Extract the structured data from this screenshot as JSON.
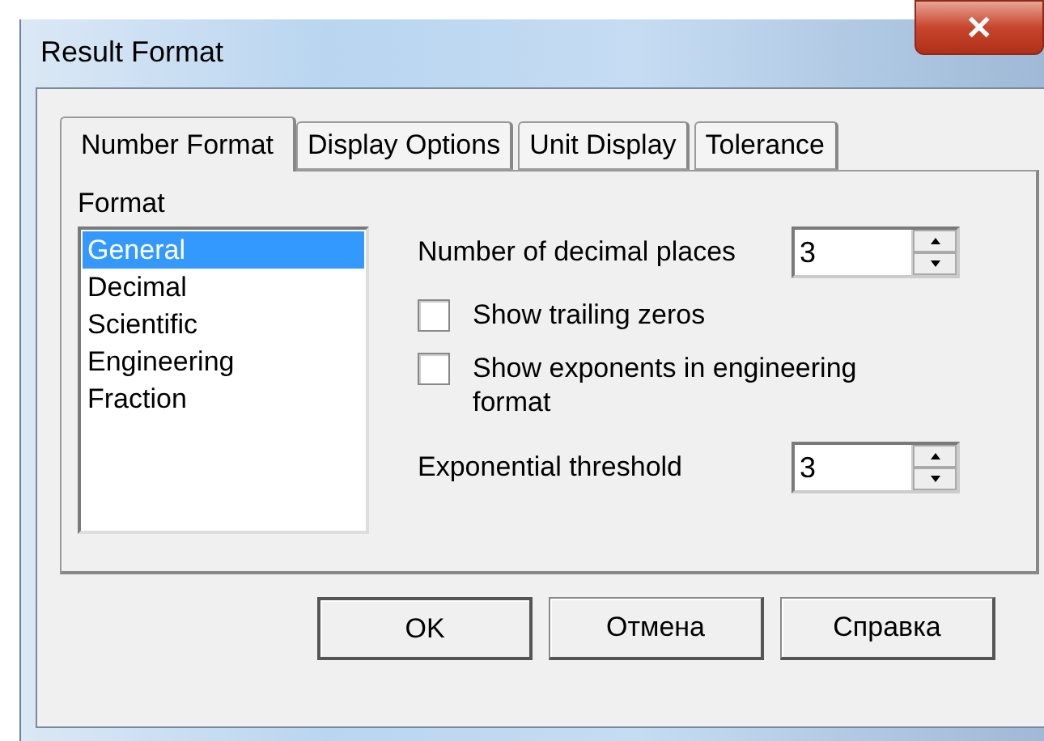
{
  "window": {
    "title": "Result Format",
    "close": "✕"
  },
  "tabs": [
    {
      "label": "Number Format",
      "selected": true
    },
    {
      "label": "Display Options",
      "selected": false
    },
    {
      "label": "Unit Display",
      "selected": false
    },
    {
      "label": "Tolerance",
      "selected": false
    }
  ],
  "format_list": {
    "label": "Format",
    "items": [
      {
        "label": "General",
        "selected": true
      },
      {
        "label": "Decimal",
        "selected": false
      },
      {
        "label": "Scientific",
        "selected": false
      },
      {
        "label": "Engineering",
        "selected": false
      },
      {
        "label": "Fraction",
        "selected": false
      }
    ]
  },
  "decimal_places": {
    "label": "Number of decimal places",
    "value": "3"
  },
  "checkboxes": [
    {
      "label": "Show trailing zeros",
      "checked": false
    },
    {
      "label": "Show exponents in engineering format",
      "checked": false
    }
  ],
  "exponential_threshold": {
    "label": "Exponential threshold",
    "value": "3"
  },
  "buttons": [
    {
      "label": "OK",
      "default": true
    },
    {
      "label": "Отмена",
      "default": false
    },
    {
      "label": "Справка",
      "default": false
    }
  ]
}
